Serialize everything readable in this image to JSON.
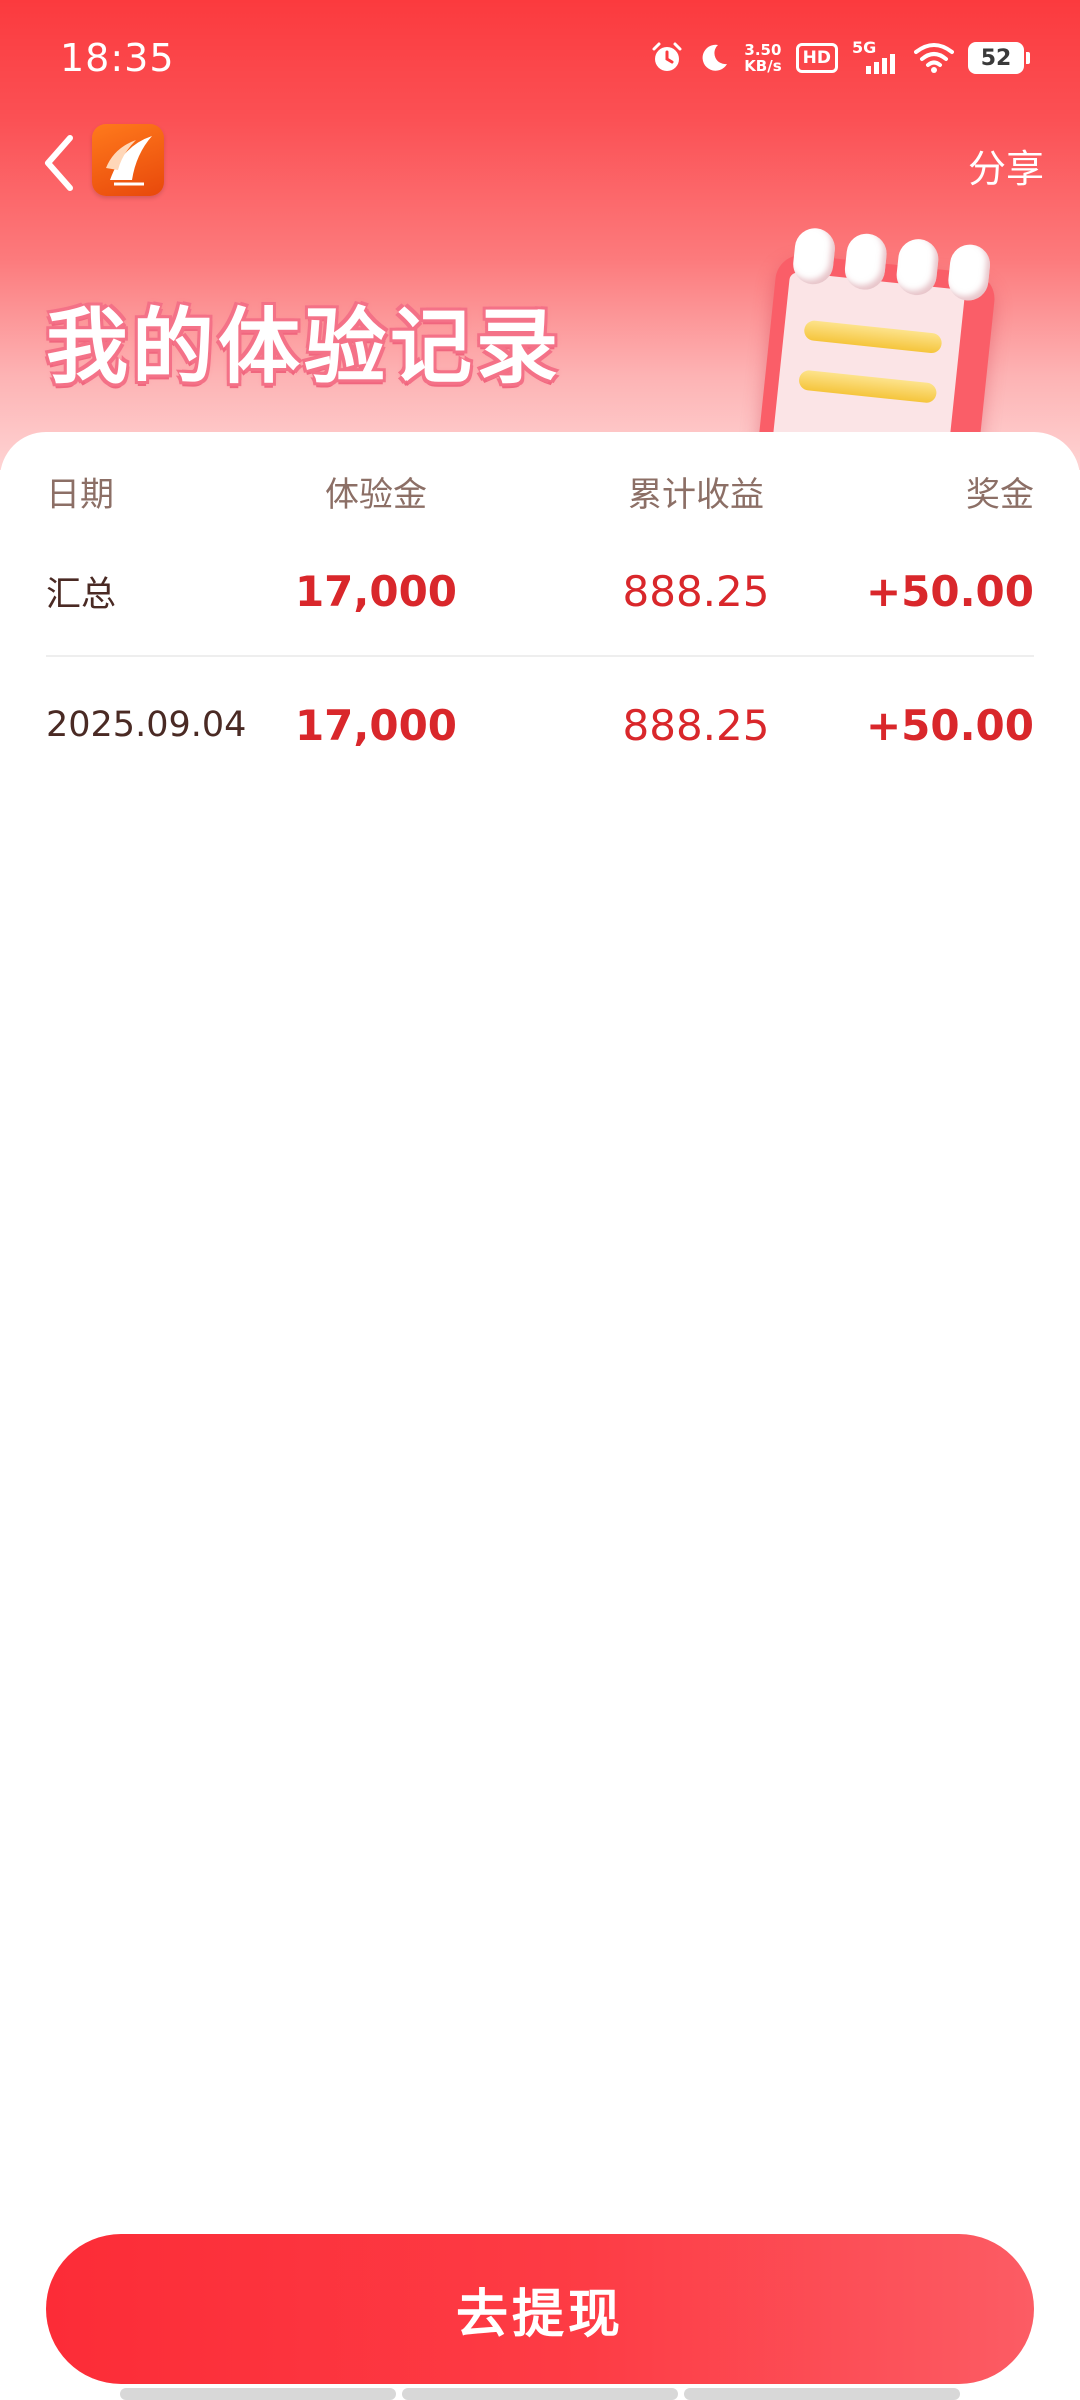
{
  "status_bar": {
    "time": "18:35",
    "net_speed_value": "3.50",
    "net_speed_unit": "KB/s",
    "hd": "HD",
    "network": "5G",
    "battery": "52",
    "icons": [
      "alarm-icon",
      "moon-icon",
      "signal-icon",
      "wifi-icon",
      "battery-icon"
    ]
  },
  "nav": {
    "back_icon": "chevron-left-icon",
    "logo_icon": "app-logo-icon",
    "share_label": "分享"
  },
  "hero": {
    "title": "我的体验记录",
    "illustration": "calendar-icon"
  },
  "table": {
    "headers": [
      "日期",
      "体验金",
      "累计收益",
      "奖金"
    ],
    "rows": [
      {
        "date": "汇总",
        "amount": "17,000",
        "earnings": "888.25",
        "bonus": "+50.00"
      },
      {
        "date": "2025.09.04",
        "amount": "17,000",
        "earnings": "888.25",
        "bonus": "+50.00"
      }
    ]
  },
  "actions": {
    "withdraw_label": "去提现"
  },
  "colors": {
    "primary_red": "#fc2c37",
    "value_red": "#d9272b",
    "header_text": "#8c6f66"
  }
}
